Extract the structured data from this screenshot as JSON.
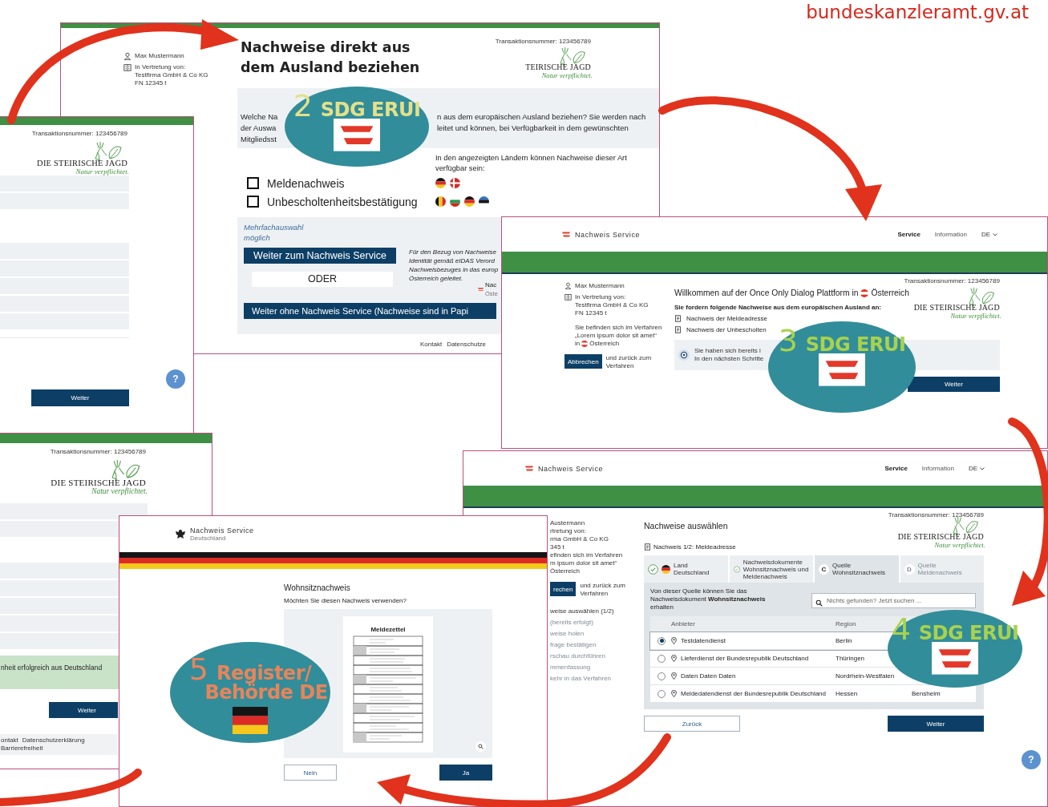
{
  "source": "bundeskanzleramt.gv.at",
  "request_window": {
    "user": {
      "name": "Max Mustermann",
      "representing_label": "In Vertretung von:",
      "company": "Testfirma GmbH & Co KG",
      "register_number": "FN 12345 t"
    },
    "title": "Nachweise direkt aus dem Ausland beziehen",
    "transaction": "Transaktionsnummer: 123456789",
    "logo": {
      "name": "TEIRISCHE JAGD",
      "slogan": "Natur verpflichtet."
    },
    "intro_left": [
      "Welche Na",
      "der Auswa",
      "Mitgliedsst"
    ],
    "intro_right": [
      "n aus dem europäischen Ausland beziehen? Sie werden nach",
      "leitet und können, bei Verfügbarkeit in dem gewünschten"
    ],
    "countries_note": "In den angezeigten Ländern können Nachweise dieser Art verfügbar sein:",
    "proofs": [
      {
        "label": "Meldenachweis",
        "checked": false
      },
      {
        "label": "Unbescholtenheitsbestätigung",
        "checked": false
      }
    ],
    "multi_hint": "Mehrfachauswahl möglich",
    "primary_button": "Weiter zum Nachweis Service",
    "separator": "ODER",
    "secondary_button": "Weiter ohne Nachweis Service (Nachweise sind in Papi",
    "eidas_note": [
      "Für den Bezug von Nachweise",
      "Identität gemäß eIDAS Verord",
      "Nachweisbezuges in das europ",
      "Österreich geleitet."
    ],
    "service_logo": {
      "name": "Nac",
      "sub": "Öste"
    },
    "footer_links": [
      "Kontakt",
      "Datenschutze"
    ]
  },
  "summary_window": {
    "transaction": "Transaktionsnummer: 123456789",
    "logo": {
      "name": "DIE STEIRISCHE JAGD",
      "slogan": "Natur verpflichtet."
    },
    "help": "?",
    "button": "Weiter"
  },
  "success_window": {
    "transaction": "Transaktionsnummer: 123456789",
    "logo": {
      "name": "DIE STEIRISCHE JAGD",
      "slogan": "Natur verpflichtet."
    },
    "success": "nheit erfolgreich aus Deutschland",
    "button": "Weiter",
    "footer_links": [
      "ontakt",
      "Datenschutzerklärung",
      "Barrierefreiheit"
    ]
  },
  "welcome_window": {
    "service": "Nachweis Service",
    "nav": [
      {
        "label": "Service",
        "selected": true
      },
      {
        "label": "Information",
        "selected": false
      }
    ],
    "language": "DE",
    "transaction": "Transaktionsnummer: 123456789",
    "user": {
      "name": "Max Mustermann",
      "representing_label": "In Vertretung von:",
      "company": "Testfirma GmbH & Co KG",
      "register_number": "FN 12345 t"
    },
    "procedure": [
      "Sie befinden sich im Verfahren",
      "„Lorem ipsum dolor sit amet“"
    ],
    "procedure_prefix": "in",
    "procedure_country": "Österreich",
    "cancel_button": "Abbrechen",
    "cancel_note": "und zurück zum Verfahren",
    "title": "Willkommen auf der Once Only Dialog Plattform in",
    "title_country": "Österreich",
    "requested_heading": "Sie fordern folgende Nachweise aus dem europäischen Ausland an:",
    "requested": [
      "Nachweis der Meldeadresse",
      "Nachweis der Unbescholten"
    ],
    "info": [
      "Sie haben sich bereits i",
      "In den nächsten Schritte"
    ],
    "button": "Weiter",
    "logo": {
      "name": "DIE STEIRISCHE JAGD",
      "slogan": "Natur verpflichtet."
    }
  },
  "select_window": {
    "service": "Nachweis Service",
    "nav": [
      {
        "label": "Service",
        "selected": true
      },
      {
        "label": "Information",
        "selected": false
      }
    ],
    "language": "DE",
    "transaction": "Transaktionsnummer: 123456789",
    "user_partial": [
      "Austermann",
      "rtretung von:",
      "rma GmbH & Co KG",
      "345 t",
      "efinden sich im Verfahren",
      "m ipsum dolor sit amet“",
      "Österreich"
    ],
    "cancel_button": "rechen",
    "cancel_note": "und zurück zum Verfahren",
    "steps_nav": [
      {
        "label": "weise auswählen (1/2)",
        "disabled": false
      },
      {
        "label": "(bereits erfolgt)",
        "disabled": true
      },
      {
        "label": "weise holen",
        "disabled": true
      },
      {
        "label": "frage bestätigen",
        "disabled": true
      },
      {
        "label": "rschau durchführen",
        "disabled": true
      },
      {
        "label": "mmenfassung",
        "disabled": true
      },
      {
        "label": "kehr in das Verfahren",
        "disabled": true
      }
    ],
    "title": "Nachweise auswählen",
    "subtitle": "Nachweis 1/2: Meldeadresse",
    "logo": {
      "name": "DIE STEIRISCHE JAGD",
      "slogan": "Natur verpflichtet."
    },
    "stepper": [
      {
        "kind": "country",
        "caption": "Land",
        "label": "Deutschland",
        "selected": false
      },
      {
        "kind": "done",
        "caption": "Nachweisdokumente",
        "label": "Wohnsitznachweis und Meldenachweis",
        "selected": false
      },
      {
        "kind": "current",
        "marker": "C",
        "caption": "Quelle",
        "label": "Wohnsitznachweis",
        "selected": true
      },
      {
        "kind": "pending",
        "marker": "D",
        "caption": "Quelle",
        "label": "Meldenachweis",
        "selected": false
      }
    ],
    "source_text": "Von dieser Quelle können Sie das Nachweisdokument **Wohnsitznachweis** erhalten",
    "search_placeholder": "Nichts gefunden? Jetzt suchen ...",
    "columns": [
      "Anbieter",
      "Region"
    ],
    "rows": [
      {
        "provider": "Testdatendienst",
        "region": "Berlin",
        "selected": true
      },
      {
        "provider": "Lieferdienst der Bundesrepublik Deutschland",
        "region": "Thüringen",
        "selected": false
      },
      {
        "provider": "Daten Daten Daten",
        "region": "Nordrhein-Westfalen",
        "selected": false
      },
      {
        "provider": "Meldedatendienst der Bundesrepublik Deutschland",
        "region": "Hessen",
        "column_3": "Bensheim",
        "selected": false
      }
    ],
    "back_button": "Zurück",
    "next_button": "Weiter",
    "help": "?"
  },
  "register_window": {
    "service": "Nachweis Service",
    "country": "Deutschland",
    "title": "Wohnsitznachweis",
    "question": "Möchten Sie diesen Nachweis verwenden?",
    "document_title": "Meldezettel",
    "no_button": "Nein",
    "yes_button": "Ja"
  },
  "badges": [
    {
      "kind": "sdg",
      "number": "2",
      "lines": [
        "SDG ERUI"
      ],
      "color": "#e4e08a"
    },
    {
      "kind": "sdg",
      "number": "3",
      "lines": [
        "SDG ERUI"
      ],
      "color": "#a9d24c"
    },
    {
      "kind": "sdg",
      "number": "4",
      "lines": [
        "SDG ERUI"
      ],
      "color": "#a9d24c"
    },
    {
      "kind": "register",
      "number": "5",
      "lines": [
        "Register/",
        "Behörde DE"
      ],
      "color": "#e8845a"
    }
  ]
}
